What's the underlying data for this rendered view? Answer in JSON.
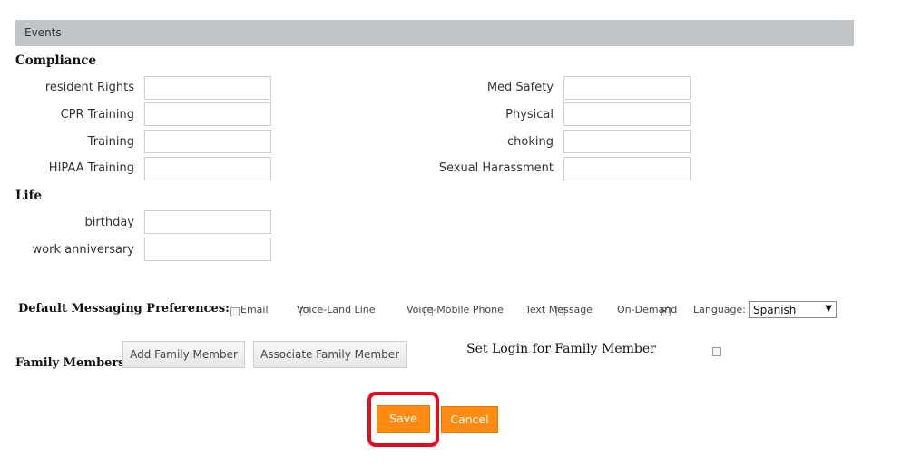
{
  "section": {
    "title": "Events"
  },
  "compliance": {
    "title": "Compliance",
    "left_fields": [
      {
        "label": "resident Rights",
        "value": ""
      },
      {
        "label": "CPR Training",
        "value": ""
      },
      {
        "label": "Training",
        "value": ""
      },
      {
        "label": "HIPAA Training",
        "value": ""
      }
    ],
    "right_fields": [
      {
        "label": "Med Safety",
        "value": ""
      },
      {
        "label": "Physical",
        "value": ""
      },
      {
        "label": "choking",
        "value": ""
      },
      {
        "label": "Sexual Harassment",
        "value": ""
      }
    ]
  },
  "life": {
    "title": "Life",
    "fields": [
      {
        "label": "birthday",
        "value": ""
      },
      {
        "label": "work anniversary",
        "value": ""
      }
    ]
  },
  "messaging": {
    "title": "Default Messaging Preferences:",
    "options": [
      {
        "label": "Email",
        "checked": false
      },
      {
        "label": "Voice-Land Line",
        "checked": false
      },
      {
        "label": "Voice-Mobile Phone",
        "checked": false
      },
      {
        "label": "Text Message",
        "checked": false
      },
      {
        "label": "On-Demand",
        "checked": true
      }
    ],
    "language_label": "Language:",
    "language_value": "Spanish"
  },
  "family": {
    "title": "Family Members",
    "add_button": "Add Family Member",
    "associate_button": "Associate Family Member",
    "set_login_label": "Set Login for Family Member",
    "set_login_checked": false
  },
  "actions": {
    "save": "Save",
    "cancel": "Cancel"
  },
  "colors": {
    "section_bar": "#c2c5c8",
    "button_orange": "#ff8b13",
    "highlight_red": "#e8091a"
  }
}
